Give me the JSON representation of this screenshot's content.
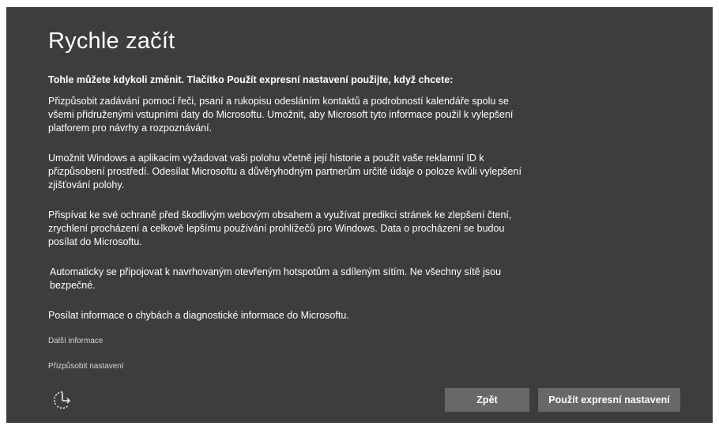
{
  "page": {
    "title": "Rychle začít",
    "intro": "Tohle můžete kdykoli změnit. Tlačítko Použít expresní nastavení použijte, když chcete:",
    "paragraphs": [
      "Přizpůsobit zadávání pomocí řeči, psaní a rukopisu odesláním kontaktů a podrobností kalendáře spolu se všemi přidruženými vstupními daty do Microsoftu. Umožnit, aby Microsoft tyto informace použil k vylepšení platforem pro návrhy a rozpoznávání.",
      "Umožnit Windows a aplikacím vyžadovat vaši polohu včetně její historie a použít vaše reklamní ID k přizpůsobení prostředí. Odesílat Microsoftu a důvěryhodným partnerům určité údaje o poloze kvůli vylepšení zjišťování polohy.",
      "Přispívat ke své ochraně před škodlivým webovým obsahem a využívat predikci stránek ke zlepšení čtení, zrychlení procházení a celkově lepšímu používání prohlížečů pro Windows. Data o procházení se budou posílat do Microsoftu.",
      "Automaticky se připojovat k navrhovaným otevřeným hotspotům a sdíleným sítím. Ne všechny sítě jsou bezpečné.",
      "Posílat informace o chybách a diagnostické informace do Microsoftu."
    ],
    "links": {
      "more_info": "Další informace",
      "customize": "Přizpůsobit nastavení"
    },
    "buttons": {
      "back": "Zpět",
      "express": "Použít expresní nastavení"
    },
    "icons": {
      "accessibility": "ease-of-access-icon"
    },
    "colors": {
      "background": "#3d3d3d",
      "button": "#686868",
      "text": "#ffffff"
    }
  }
}
